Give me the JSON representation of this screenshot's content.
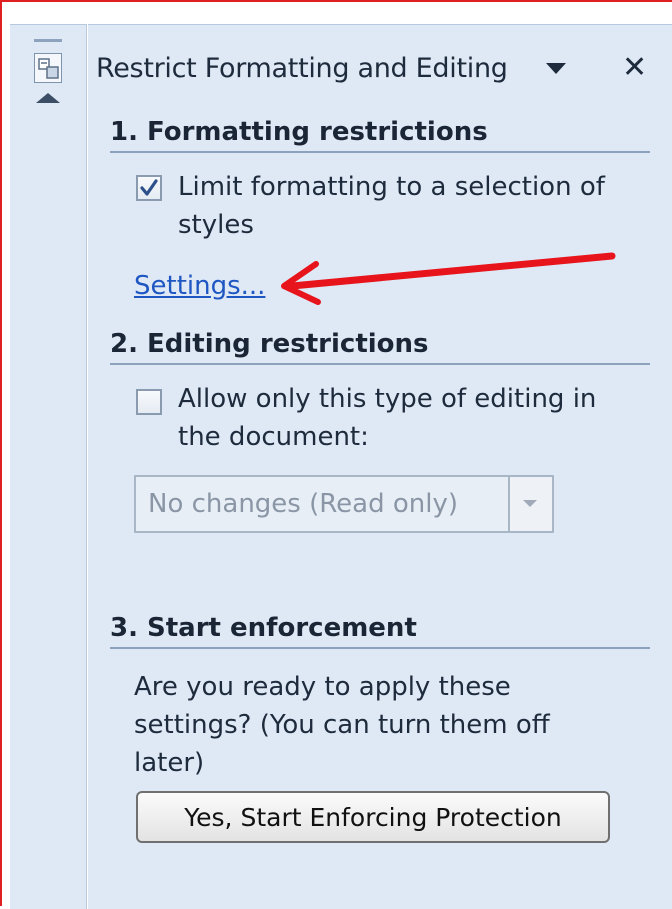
{
  "pane": {
    "title": "Restrict Formatting and Editing"
  },
  "sections": {
    "formatting": {
      "heading": "1. Formatting restrictions",
      "checkbox_label_line1": "Limit formatting to a selection of",
      "checkbox_label_line2": "styles",
      "checkbox_checked": true,
      "settings_link": "Settings..."
    },
    "editing": {
      "heading": "2. Editing restrictions",
      "checkbox_label_line1": "Allow only this type of editing in",
      "checkbox_label_line2": "the document:",
      "checkbox_checked": false,
      "dropdown_value": "No changes (Read only)"
    },
    "enforcement": {
      "heading": "3. Start enforcement",
      "text_line1": "Are you ready to apply these",
      "text_line2": "settings? (You can turn them off",
      "text_line3": "later)",
      "button_label": "Yes, Start Enforcing Protection"
    }
  },
  "colors": {
    "annotation_arrow": "#e8141c",
    "link": "#1f57c2",
    "pane_background": "#dfe9f5"
  },
  "icons": {
    "pane_icon": "task-pane-icon",
    "scroll_up": "scroll-up-arrow-icon",
    "menu": "chevron-down-icon",
    "close": "close-icon"
  }
}
